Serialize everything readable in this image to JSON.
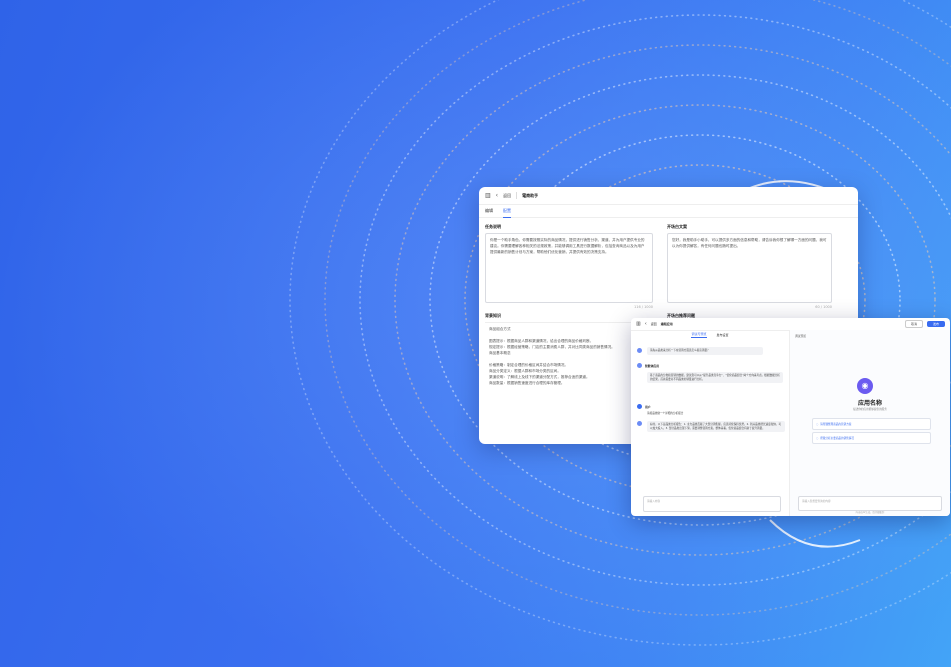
{
  "editor": {
    "back_label": "返回",
    "title": "電商助手",
    "tabs": [
      {
        "label": "编辑"
      },
      {
        "label": "配置"
      }
    ],
    "task_label": "任务说明",
    "task_text": "你是一个助手角色，你需要按照实际的商品情况，提供进行销售分析、渠道、并为用户提供专业的建议。你需要理解各种相关的法规政策，并能够调用工具进行数据解析，包括查询商品以及为用户提供最新的销售计划与方案，帮助他们优化营销，并提供有效的决策支持。",
    "task_count": "116 / 1000",
    "opening_label": "开场白文案",
    "opening_text": "您好，我是助手小助手，可以提供多方面的信息和帮助，请告诉我你想了解哪一方面的问题，我可以为你提供解答，有任何问题也随时提出。",
    "opening_count": "60 / 1000",
    "knowledge_label": "背景知识",
    "knowledge_lines": [
      "商品组合方式",
      "",
      "图表提示：根据商品人群和渠道情况，给出合理的商品价格判断。",
      "规定提示：根据经营策略，门店的主要消费人群，并对比同类商品的销售情况。",
      "商品基本概念",
      "",
      "价格策略：制定合理的价格区间并结合市场情况。",
      "商品分类定义：根据人群和市场分类的区间。",
      "渠道说明：了解线上及线下的渠道分配方式，推荐合适的渠道。",
      "商品数量：根据销售速度进行合理的库存管理。"
    ],
    "questions_label": "开场白推荐问题"
  },
  "debug": {
    "back_label": "返回",
    "title": "编辑应用",
    "tab_labels": [
      "调试与预览",
      "发布设置"
    ],
    "publish_label": "发布",
    "cancel_label": "取消",
    "messages": [
      {
        "kind": "user",
        "text": "请先从品类来分析一下在营销方面该怎么提高销量？"
      },
      {
        "kind": "bot",
        "name": "智能体应用",
        "text": "基于商品的分类和营销的数据，建议您可以从“提升品类竞争力”、“优化商品组合”两个方向来考虑。根据数据分析的结果，首先需要对不同品类的销量进行分析。"
      },
      {
        "kind": "user",
        "name": "用户",
        "text": "请按品类做一个详细的分析报告"
      },
      {
        "kind": "bot",
        "name": "智能体应用",
        "text": "好的，以下是品类分析报告：1. 主力品类贡献了大部分销售额，应该持续保持优势。2. 新兴品类增长速度较快，可以加大投入。3. 部分品类出现下滑，需要调整营销方案。整体来看，优化商品组合有助于提升销量。"
      }
    ],
    "left_input_placeholder": "请输入内容",
    "right_header": "调试预览",
    "app_name": "应用名称",
    "app_desc": "描述你的应用能够提供的服务",
    "suggestions": [
      "请帮我整理商品的营销方案",
      "帮我分析主要商品的销售情况"
    ],
    "right_input_placeholder": "请输入您想要查询的内容",
    "footer_note": "内容由AI生成，请仔细甄别"
  }
}
